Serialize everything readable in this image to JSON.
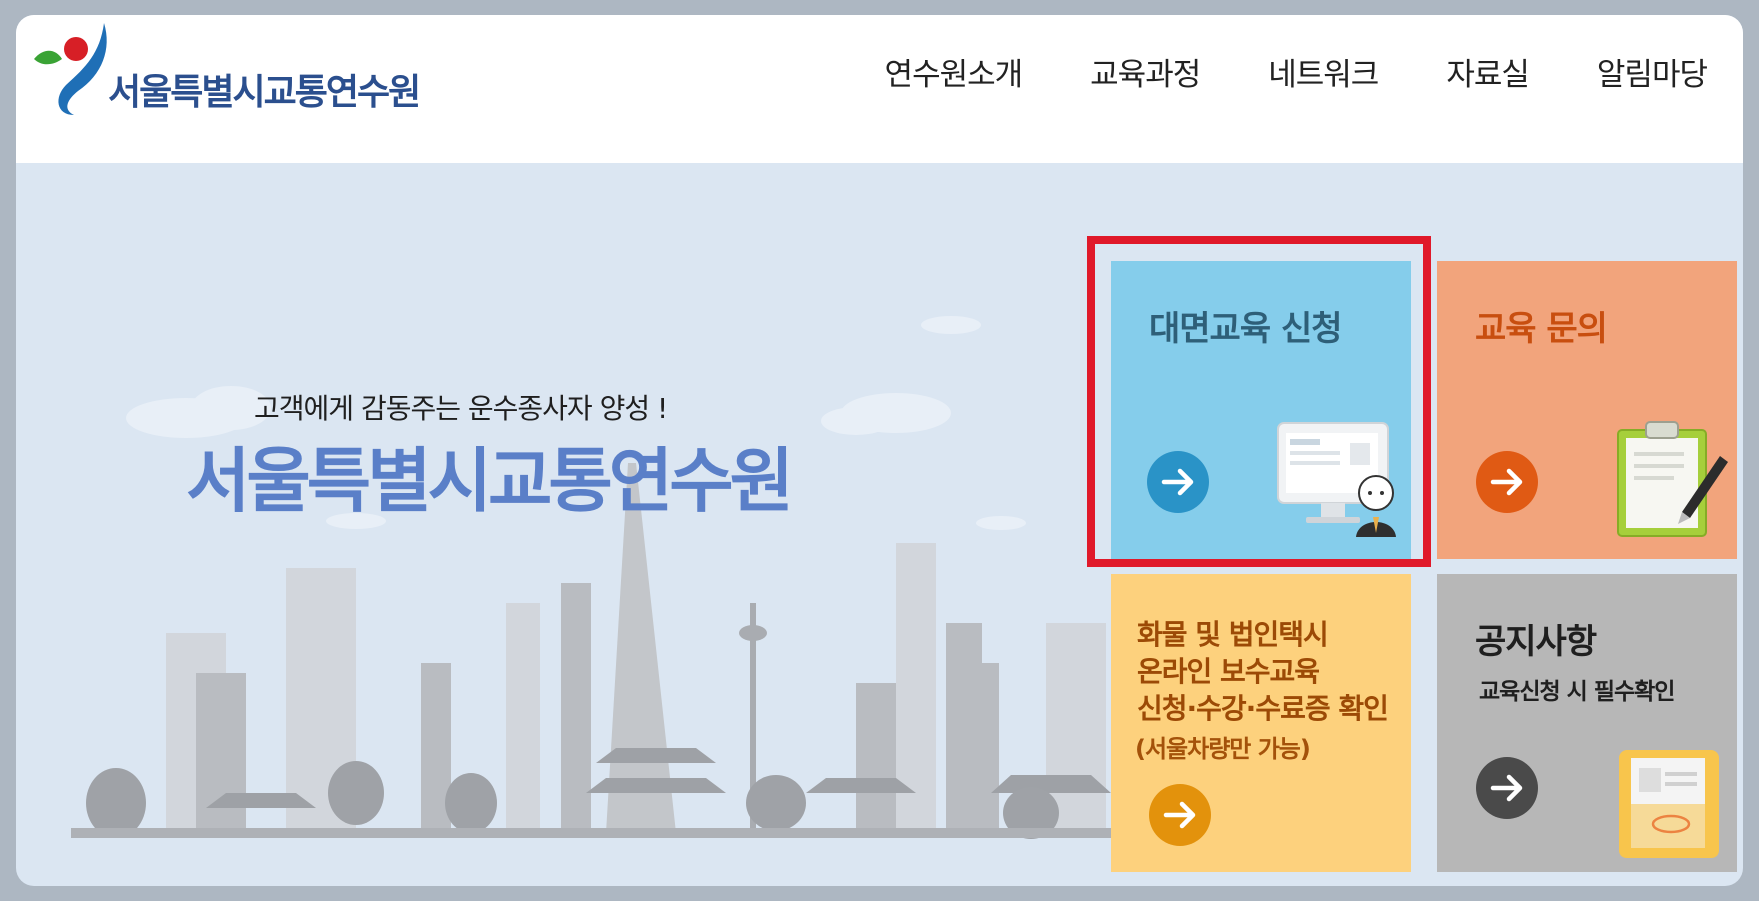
{
  "brand": {
    "name": "서울특별시교통연수원"
  },
  "nav": [
    {
      "label": "연수원소개"
    },
    {
      "label": "교육과정"
    },
    {
      "label": "네트워크"
    },
    {
      "label": "자료실"
    },
    {
      "label": "알림마당"
    }
  ],
  "hero": {
    "tagline": "고객에게 감동주는 운수종사자 양성 !",
    "title": "서울특별시교통연수원"
  },
  "tiles": {
    "offline_apply": {
      "title": "대면교육 신청",
      "color": "#85cdeb",
      "arrow_color": "#2a93c7",
      "icon": "computer-user-icon"
    },
    "inquiry": {
      "title": "교육 문의",
      "color": "#f2a47c",
      "arrow_color": "#e05a14",
      "icon": "clipboard-pen-icon"
    },
    "online": {
      "line1": "화물 및 법인택시",
      "line2": "온라인 보수교육",
      "line3": "신청·수강·수료증 확인",
      "note": "(서울차량만 가능)",
      "color": "#fdd17d",
      "arrow_color": "#e3920c"
    },
    "notice": {
      "title": "공지사항",
      "subtitle": "교육신청 시 필수확인",
      "color": "#b7b7b7",
      "arrow_color": "#4a4a4a",
      "icon": "folder-document-icon"
    }
  },
  "highlight_color": "#e0192a"
}
